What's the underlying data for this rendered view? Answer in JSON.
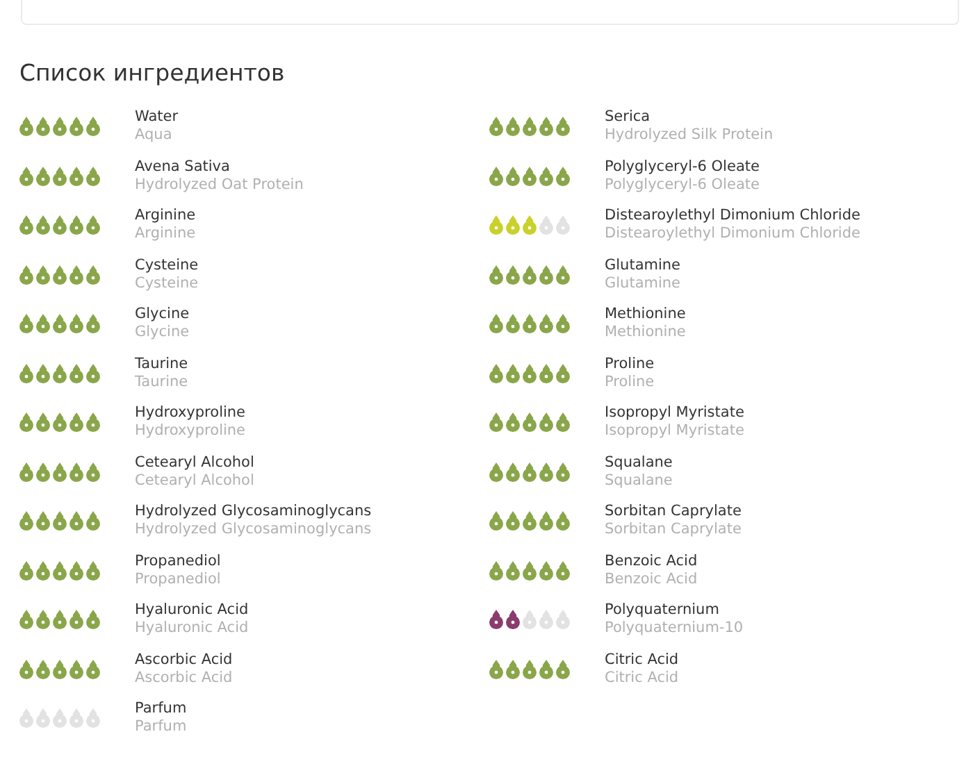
{
  "title": "Список ингредиентов",
  "ingredients": [
    {
      "name": "Water",
      "inci": "Aqua",
      "stars": 5,
      "color": "#8aa64a"
    },
    {
      "name": "Serica",
      "inci": "Hydrolyzed Silk Protein",
      "stars": 5,
      "color": "#8aa64a"
    },
    {
      "name": "Avena Sativa",
      "inci": "Hydrolyzed Oat Protein",
      "stars": 5,
      "color": "#8aa64a"
    },
    {
      "name": "Polyglyceryl-6 Oleate",
      "inci": "Polyglyceryl-6 Oleate",
      "stars": 5,
      "color": "#8aa64a"
    },
    {
      "name": "Arginine",
      "inci": "Arginine",
      "stars": 5,
      "color": "#8aa64a"
    },
    {
      "name": "Distearoylethyl Dimonium Chloride",
      "inci": "Distearoylethyl Dimonium Chloride",
      "stars": 3,
      "color": "#c9d12b"
    },
    {
      "name": "Cysteine",
      "inci": "Cysteine",
      "stars": 5,
      "color": "#8aa64a"
    },
    {
      "name": "Glutamine",
      "inci": "Glutamine",
      "stars": 5,
      "color": "#8aa64a"
    },
    {
      "name": "Glycine",
      "inci": "Glycine",
      "stars": 5,
      "color": "#8aa64a"
    },
    {
      "name": "Methionine",
      "inci": "Methionine",
      "stars": 5,
      "color": "#8aa64a"
    },
    {
      "name": "Taurine",
      "inci": "Taurine",
      "stars": 5,
      "color": "#8aa64a"
    },
    {
      "name": "Proline",
      "inci": "Proline",
      "stars": 5,
      "color": "#8aa64a"
    },
    {
      "name": "Hydroxyproline",
      "inci": "Hydroxyproline",
      "stars": 5,
      "color": "#8aa64a"
    },
    {
      "name": "Isopropyl Myristate",
      "inci": "Isopropyl Myristate",
      "stars": 5,
      "color": "#8aa64a"
    },
    {
      "name": "Cetearyl Alcohol",
      "inci": "Cetearyl Alcohol",
      "stars": 5,
      "color": "#8aa64a"
    },
    {
      "name": "Squalane",
      "inci": "Squalane",
      "stars": 5,
      "color": "#8aa64a"
    },
    {
      "name": "Hydrolyzed Glycosaminoglycans",
      "inci": "Hydrolyzed Glycosaminoglycans",
      "stars": 5,
      "color": "#8aa64a"
    },
    {
      "name": "Sorbitan Caprylate",
      "inci": "Sorbitan Caprylate",
      "stars": 5,
      "color": "#8aa64a"
    },
    {
      "name": "Propanediol",
      "inci": "Propanediol",
      "stars": 5,
      "color": "#8aa64a"
    },
    {
      "name": "Benzoic Acid",
      "inci": "Benzoic Acid",
      "stars": 5,
      "color": "#8aa64a"
    },
    {
      "name": "Hyaluronic Acid",
      "inci": "Hyaluronic Acid",
      "stars": 5,
      "color": "#8aa64a"
    },
    {
      "name": "Polyquaternium",
      "inci": "Polyquaternium-10",
      "stars": 2,
      "color": "#8a3c6c"
    },
    {
      "name": "Ascorbic Acid",
      "inci": "Ascorbic Acid",
      "stars": 5,
      "color": "#8aa64a"
    },
    {
      "name": "Citric Acid",
      "inci": "Citric Acid",
      "stars": 5,
      "color": "#8aa64a"
    },
    {
      "name": "Parfum",
      "inci": "Parfum",
      "stars": 0
    }
  ]
}
